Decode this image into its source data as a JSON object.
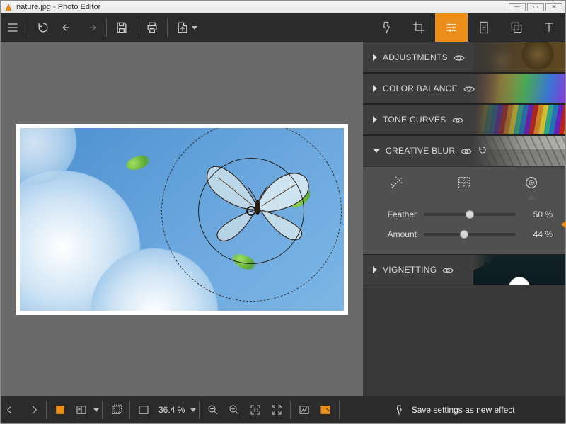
{
  "window": {
    "title": "nature.jpg - Photo Editor"
  },
  "panels": {
    "adjustments": {
      "label": "ADJUSTMENTS"
    },
    "color_balance": {
      "label": "COLOR BALANCE"
    },
    "tone_curves": {
      "label": "TONE CURVES"
    },
    "creative_blur": {
      "label": "CREATIVE BLUR"
    },
    "vignetting": {
      "label": "VIGNETTING"
    }
  },
  "creative_blur": {
    "feather": {
      "label": "Feather",
      "value": 50,
      "display": "50 %"
    },
    "amount": {
      "label": "Amount",
      "value": 44,
      "display": "44 %"
    },
    "selected_mode": "radial"
  },
  "zoom": {
    "display": "36.4 %"
  },
  "footer": {
    "save_effect": "Save settings as new effect"
  }
}
